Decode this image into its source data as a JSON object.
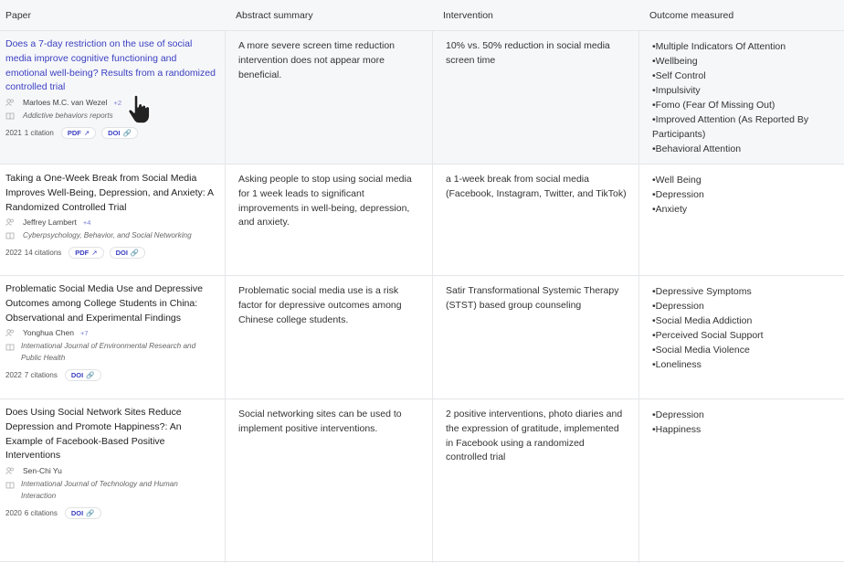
{
  "columns": [
    "Paper",
    "Abstract summary",
    "Intervention",
    "Outcome measured"
  ],
  "rows": [
    {
      "title": "Does a 7-day restriction on the use of social media improve cognitive functioning and emotional well-being? Results from a randomized controlled trial",
      "author": "Marloes M.C. van Wezel",
      "more_authors": "+2",
      "journal": "Addictive behaviors reports",
      "year": "2021",
      "citations": "1 citation",
      "pdf_label": "PDF",
      "doi_label": "DOI",
      "summary": "A more severe screen time reduction intervention does not appear more beneficial.",
      "intervention": "10% vs. 50% reduction in social media screen time",
      "outcomes": [
        "•Multiple Indicators Of Attention",
        "•Wellbeing",
        "•Self Control",
        "•Impulsivity",
        "•Fomo (Fear Of Missing Out)",
        "•Improved Attention (As Reported By Participants)",
        "•Behavioral Attention"
      ]
    },
    {
      "title": "Taking a One-Week Break from Social Media Improves Well-Being, Depression, and Anxiety: A Randomized Controlled Trial",
      "author": "Jeffrey Lambert",
      "more_authors": "+4",
      "journal": "Cyberpsychology, Behavior, and Social Networking",
      "year": "2022",
      "citations": "14 citations",
      "pdf_label": "PDF",
      "doi_label": "DOI",
      "summary": "Asking people to stop using social media for 1 week leads to significant improvements in well-being, depression, and anxiety.",
      "intervention": "a 1-week break from social media (Facebook, Instagram, Twitter, and TikTok)",
      "outcomes": [
        "•Well Being",
        "•Depression",
        "•Anxiety"
      ]
    },
    {
      "title": "Problematic Social Media Use and Depressive Outcomes among College Students in China: Observational and Experimental Findings",
      "author": "Yonghua Chen",
      "more_authors": "+7",
      "journal": "International Journal of Environmental Research and Public Health",
      "year": "2022",
      "citations": "7 citations",
      "doi_label": "DOI",
      "summary": "Problematic social media use is a risk factor for depressive outcomes among Chinese college students.",
      "intervention": "Satir Transformational Systemic Therapy (STST) based group counseling",
      "outcomes": [
        "•Depressive Symptoms",
        "•Depression",
        "•Social Media Addiction",
        "•Perceived Social Support",
        "•Social Media Violence",
        "•Loneliness"
      ]
    },
    {
      "title": "Does Using Social Network Sites Reduce Depression and Promote Happiness?: An Example of Facebook-Based Positive Interventions",
      "author": "Sen-Chi Yu",
      "more_authors": "",
      "journal": "International Journal of Technology and Human Interaction",
      "year": "2020",
      "citations": "6 citations",
      "doi_label": "DOI",
      "summary": "Social networking sites can be used to implement positive interventions.",
      "intervention": "2 positive interventions, photo diaries and the expression of gratitude, implemented in Facebook using a randomized controlled trial",
      "outcomes": [
        "•Depression",
        "•Happiness"
      ]
    }
  ],
  "icons": {
    "author": "people-icon",
    "journal": "book-icon",
    "pdf": "external-link-icon",
    "doi": "link-icon",
    "cursor": "hand-pointer-icon"
  },
  "colors": {
    "link": "#3a3fc1",
    "header_bg": "#f6f7f9",
    "border": "#e3e5e8"
  }
}
